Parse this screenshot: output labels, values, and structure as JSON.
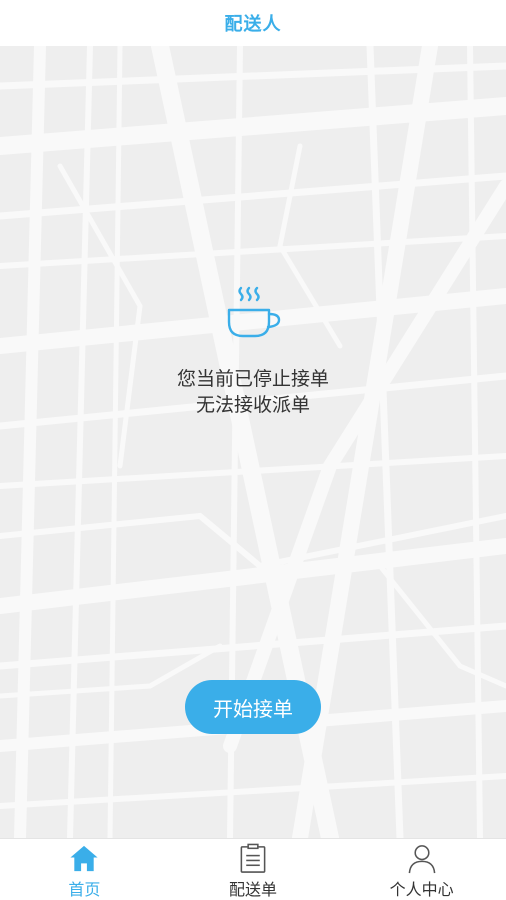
{
  "app": {
    "title": "配送人"
  },
  "colors": {
    "accent": "#3aaee9",
    "text": "#333333",
    "inactive_icon": "#555555",
    "map_bg": "#eeeeee",
    "map_road": "#f9f9f9"
  },
  "status": {
    "icon": "coffee-cup-icon",
    "line1": "您当前已停止接单",
    "line2": "无法接收派单"
  },
  "actions": {
    "start_label": "开始接单"
  },
  "tabs": [
    {
      "label": "首页",
      "icon": "home-icon",
      "active": true
    },
    {
      "label": "配送单",
      "icon": "clipboard-icon",
      "active": false
    },
    {
      "label": "个人中心",
      "icon": "user-icon",
      "active": false
    }
  ]
}
